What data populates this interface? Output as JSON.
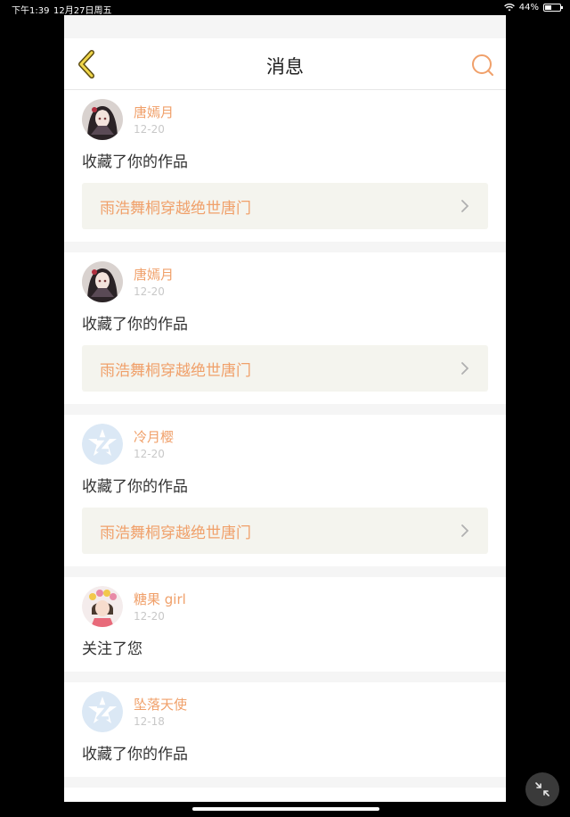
{
  "status_bar": {
    "time": "下午1:39",
    "date": "12月27日周五",
    "battery": "44%",
    "battery_level": 0.44
  },
  "header": {
    "title": "消息"
  },
  "messages": [
    {
      "name": "唐嫣月",
      "date": "12-20",
      "action": "收藏了你的作品",
      "work": "雨浩舞桐穿越绝世唐门",
      "avatar": "anime-girl-avatar"
    },
    {
      "name": "唐嫣月",
      "date": "12-20",
      "action": "收藏了你的作品",
      "work": "雨浩舞桐穿越绝世唐门",
      "avatar": "anime-girl-avatar"
    },
    {
      "name": "冷月樱",
      "date": "12-20",
      "action": "收藏了你的作品",
      "work": "雨浩舞桐穿越绝世唐门",
      "avatar": "default-z-avatar"
    },
    {
      "name": "糖果 girl",
      "date": "12-20",
      "action": "关注了您",
      "avatar": "flower-girl-avatar"
    },
    {
      "name": "坠落天使",
      "date": "12-18",
      "action": "收藏了你的作品",
      "avatar": "default-z-avatar"
    }
  ],
  "colors": {
    "accent": "#f0a06a",
    "back_arrow": "#c9a227",
    "link_bg": "#f4f4ee"
  }
}
